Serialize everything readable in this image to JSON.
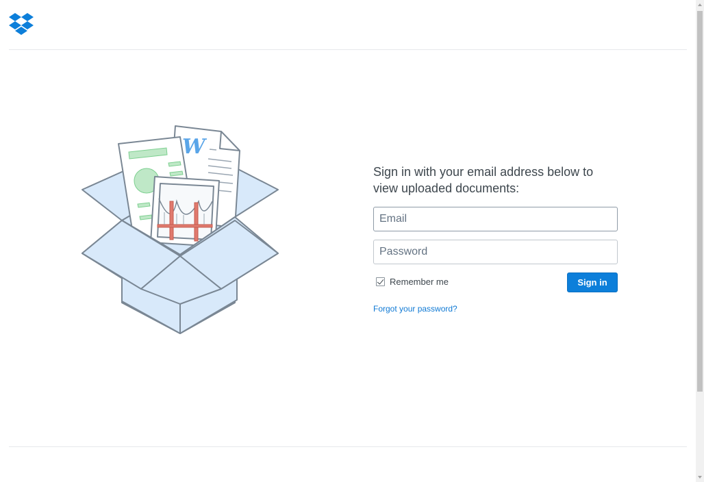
{
  "brand": {
    "logo_icon": "dropbox-logo-icon",
    "color": "#0d7fda"
  },
  "illustration": {
    "icon": "open-box-with-documents-illustration"
  },
  "signin": {
    "title": "Sign in with your email address below to view uploaded documents:",
    "email_placeholder": "Email",
    "password_placeholder": "Password",
    "remember_label": "Remember me",
    "remember_checked": true,
    "submit_label": "Sign in",
    "forgot_label": "Forgot your password?"
  },
  "colors": {
    "button": "#0d7fda",
    "link": "#0f79d4",
    "box_fill": "#d8e9fa",
    "box_stroke": "#7a8794"
  }
}
